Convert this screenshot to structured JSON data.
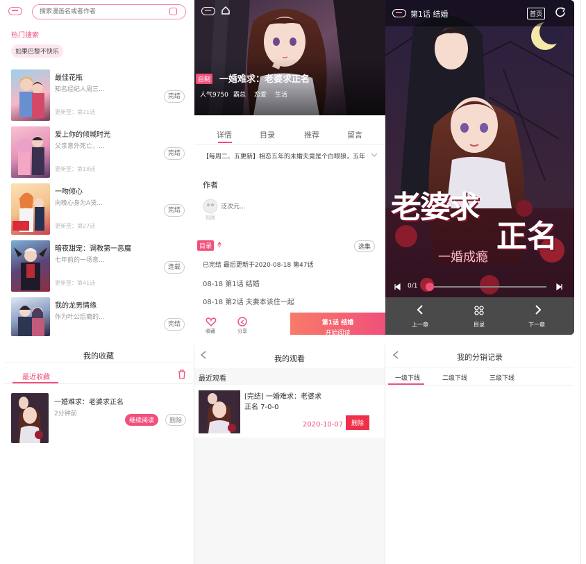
{
  "search": {
    "placeholder": "搜索漫画名或者作者"
  },
  "hot": {
    "title": "热门搜索",
    "tag": "如果巴黎不快乐"
  },
  "books": [
    {
      "title": "最佳花瓶",
      "desc": "知名经纪人周三...",
      "updated": "更新至：第21话",
      "state": "完结"
    },
    {
      "title": "爱上你的倾城时光",
      "desc": "父亲意外死亡，...",
      "updated": "更新至：第18话",
      "state": "完结"
    },
    {
      "title": "一吻倾心",
      "desc": "向晚心身为A货...",
      "updated": "更新至：第27话",
      "state": "完结"
    },
    {
      "title": "暗夜甜宠：调教第一恶魔",
      "desc": "七年前的一场意...",
      "updated": "更新至：第41话",
      "state": "连载"
    },
    {
      "title": "我的龙男情缘",
      "desc": "作为叶公后裔的...",
      "updated": "",
      "state": "完结"
    }
  ],
  "detail": {
    "badge": "自制",
    "title": "一婚难求：老婆求正名",
    "popularity": "人气9750",
    "genres": [
      "霸总",
      "恋爱",
      "生活"
    ],
    "tabs": [
      "详情",
      "目录",
      "推荐",
      "留言"
    ],
    "synopsis": "【每周二、五更新】相恋五年的未婚夫竟是个白眼狼，五年",
    "author_heading": "作者",
    "author_name": "泛次元...",
    "author_role": "出品",
    "catalog_label": "目录",
    "select_label": "选集",
    "catalog_status": "已完结 最后更新于2020-08-18 第47话",
    "chapters": [
      "08-18 第1话 结婚",
      "08-18 第2话 夫妻本该住一起"
    ],
    "fav_label": "收藏",
    "share_label": "分享",
    "read_chapter": "第1话 结婚",
    "read_action": "开始阅读"
  },
  "reader": {
    "title": "第1话 结婚",
    "home_label": "首页",
    "art_title_a": "老婆求",
    "art_title_b": "正名",
    "art_subtitle": "一婚成瘾",
    "page_indicator": "0/1",
    "progress": 0.0,
    "prev_label": "上一章",
    "catalog_label": "目录",
    "next_label": "下一章"
  },
  "favorites": {
    "title": "我的收藏",
    "tab": "最近收藏",
    "item_title": "一婚难求：老婆求正名",
    "item_time": "2分钟前",
    "continue_label": "继续阅读",
    "delete_label": "删除"
  },
  "history": {
    "title": "我的观看",
    "section": "最近观看",
    "item_title": "[完结] 一婚难求：老婆求正名 7-0-0",
    "item_date": "2020-10-07",
    "delete_label": "删除"
  },
  "distribution": {
    "title": "我的分销记录",
    "tabs": [
      "一级下线",
      "二级下线",
      "三级下线"
    ]
  },
  "colors": {
    "accent": "#f0507a",
    "reader_bar": "#4a4a4a"
  }
}
